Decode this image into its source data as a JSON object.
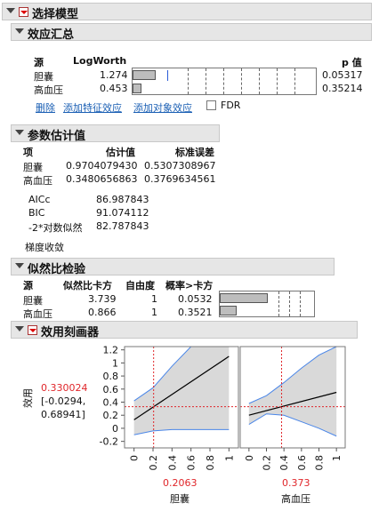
{
  "title": "选择模型",
  "effects": {
    "title": "效应汇总",
    "columns": [
      "源",
      "LogWorth",
      "p 值"
    ],
    "rows": [
      {
        "source": "胆囊",
        "logworth": "1.274",
        "pvalue": "0.05317",
        "fraction": 0.21
      },
      {
        "source": "高血压",
        "logworth": "0.453",
        "pvalue": "0.35214",
        "fraction": 0.08
      }
    ],
    "actions": [
      "删除",
      "添加特征效应",
      "添加对象效应"
    ],
    "fdr_label": "FDR"
  },
  "params": {
    "title": "参数估计值",
    "columns": [
      "项",
      "估计值",
      "标准误差"
    ],
    "rows": [
      {
        "term": "胆囊",
        "estimate": "0.9704079430",
        "se": "0.5307308967"
      },
      {
        "term": "高血压",
        "estimate": "0.3480656863",
        "se": "0.3769634561"
      }
    ],
    "fit": [
      {
        "label": "AICc",
        "value": "86.987843"
      },
      {
        "label": "BIC",
        "value": "91.074112"
      },
      {
        "label": "-2*对数似然",
        "value": "82.787843"
      }
    ],
    "note": "梯度收敛"
  },
  "lr": {
    "title": "似然比检验",
    "columns": [
      "源",
      "似然比卡方",
      "自由度",
      "概率>卡方"
    ],
    "rows": [
      {
        "source": "胆囊",
        "chisq": "3.739",
        "df": "1",
        "p": "0.0532",
        "fraction": 0.5
      },
      {
        "source": "高血压",
        "chisq": "0.866",
        "df": "1",
        "p": "0.3521",
        "fraction": 0.18
      }
    ]
  },
  "profiler": {
    "title": "效用刻画器",
    "ylabel": "效用",
    "current_value": "0.330024",
    "ci": [
      "[-0.0294,",
      "0.68941]"
    ],
    "y_ticks": [
      "1.2",
      "1",
      "0.8",
      "0.6",
      "0.4",
      "0.2",
      "0",
      "-0.2"
    ],
    "x_ticks": [
      "0",
      "0.2",
      "0.4",
      "0.6",
      "0.8",
      "1"
    ],
    "factors": [
      {
        "name": "胆囊",
        "value": "0.2063"
      },
      {
        "name": "高血压",
        "value": "0.373"
      }
    ]
  },
  "chart_data": [
    {
      "type": "line",
      "xlabel": "胆囊",
      "ylabel": "效用",
      "xlim": [
        -0.1,
        1.1
      ],
      "ylim": [
        -0.3,
        1.25
      ],
      "current": {
        "x": 0.2063,
        "y": 0.330024
      },
      "line": {
        "x": [
          0,
          1
        ],
        "y": [
          0.13,
          1.1
        ]
      },
      "band_upper": {
        "x": [
          0,
          0.2,
          0.4,
          0.6,
          0.8,
          1
        ],
        "y": [
          0.42,
          0.62,
          0.95,
          1.25,
          1.25,
          1.25
        ]
      },
      "band_lower": {
        "x": [
          0,
          0.2,
          0.4,
          0.6,
          0.8,
          1
        ],
        "y": [
          -0.1,
          -0.04,
          -0.02,
          -0.02,
          -0.02,
          -0.02
        ]
      }
    },
    {
      "type": "line",
      "xlabel": "高血压",
      "ylabel": "效用",
      "xlim": [
        -0.1,
        1.1
      ],
      "ylim": [
        -0.3,
        1.25
      ],
      "current": {
        "x": 0.373,
        "y": 0.330024
      },
      "line": {
        "x": [
          0,
          1
        ],
        "y": [
          0.2,
          0.55
        ]
      },
      "band_upper": {
        "x": [
          0,
          0.2,
          0.4,
          0.6,
          0.8,
          1
        ],
        "y": [
          0.38,
          0.5,
          0.7,
          0.92,
          1.12,
          1.25
        ]
      },
      "band_lower": {
        "x": [
          0,
          0.2,
          0.4,
          0.6,
          0.8,
          1
        ],
        "y": [
          0.06,
          0.22,
          0.2,
          0.1,
          0.0,
          -0.12
        ]
      }
    }
  ]
}
